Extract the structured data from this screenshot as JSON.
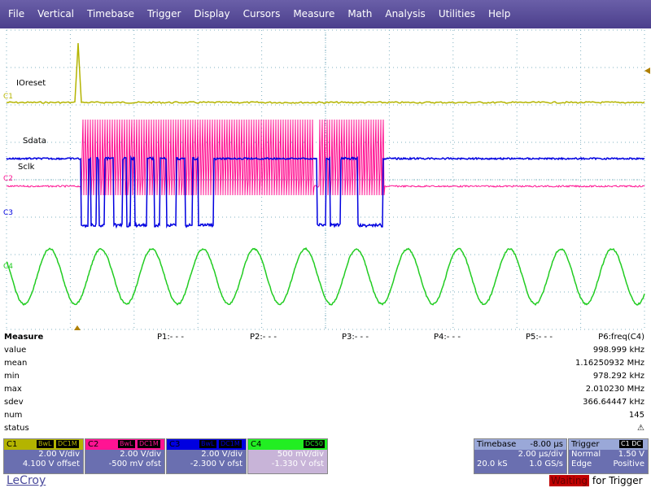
{
  "menu": [
    "File",
    "Vertical",
    "Timebase",
    "Trigger",
    "Display",
    "Cursors",
    "Measure",
    "Math",
    "Analysis",
    "Utilities",
    "Help"
  ],
  "traces": {
    "ioreset_label": "IOreset",
    "sdata_label": "Sdata",
    "sclk_label": "Sclk",
    "c1_marker": "C1",
    "c2_marker": "C2",
    "c3_marker": "C3",
    "c4_marker": "C4"
  },
  "colors": {
    "c1": "#b4b400",
    "c2": "#ff1493",
    "c3": "#0000e0",
    "c4": "#22cc22",
    "grid": "#7fb0c0"
  },
  "measure": {
    "title": "Measure",
    "params": [
      "P1:- - -",
      "P2:- - -",
      "P3:- - -",
      "P4:- - -",
      "P5:- - -",
      "P6:freq(C4)"
    ],
    "rows": [
      {
        "label": "value",
        "value": "998.999 kHz"
      },
      {
        "label": "mean",
        "value": "1.16250932 MHz"
      },
      {
        "label": "min",
        "value": "978.292 kHz"
      },
      {
        "label": "max",
        "value": "2.010230 MHz"
      },
      {
        "label": "sdev",
        "value": "366.64447 kHz"
      },
      {
        "label": "num",
        "value": "145"
      },
      {
        "label": "status",
        "value": "⚠"
      }
    ]
  },
  "channels": {
    "c1": {
      "name": "C1",
      "tag1": "BwL",
      "tag2": "DC1M",
      "line1": "2.00 V/div",
      "line2": "4.100 V offset"
    },
    "c2": {
      "name": "C2",
      "tag1": "BwL",
      "tag2": "DC1M",
      "line1": "2.00 V/div",
      "line2": "-500 mV ofst"
    },
    "c3": {
      "name": "C3",
      "tag1": "BwL",
      "tag2": "DC1M",
      "line1": "2.00 V/div",
      "line2": "-2.300 V ofst"
    },
    "c4": {
      "name": "C4",
      "tag1": "",
      "tag2": "DC50",
      "line1": "500 mV/div",
      "line2": "-1.330 V ofst"
    }
  },
  "timebase": {
    "title": "Timebase",
    "delay": "-8.00 µs",
    "tdiv": "2.00 µs/div",
    "samples": "20.0 kS",
    "rate": "1.0 GS/s"
  },
  "trigger": {
    "title": "Trigger",
    "tags": "C1 DC",
    "mode": "Normal",
    "level": "1.50 V",
    "type": "Edge",
    "slope": "Positive"
  },
  "footer": {
    "logo": "LeCroy",
    "waiting": "Waiting",
    "for_trigger": "for Trigger"
  }
}
